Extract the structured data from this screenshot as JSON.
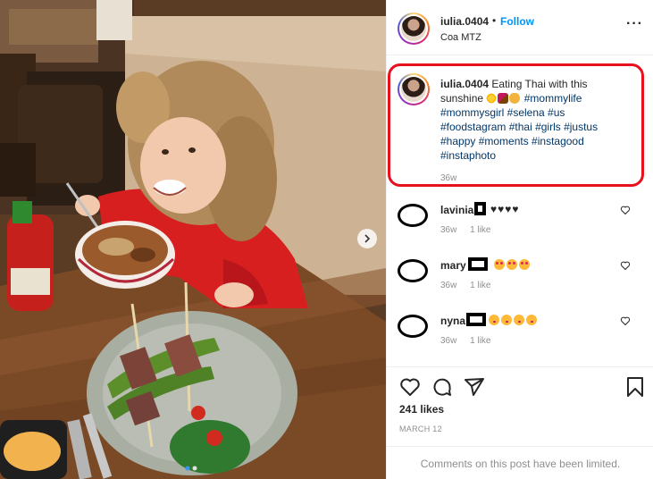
{
  "post": {
    "username": "iulia.0404",
    "separator": "•",
    "follow_label": "Follow",
    "location": "Coa MTZ",
    "more_label": "···"
  },
  "caption": {
    "username": "iulia.0404",
    "text_before": "Eating Thai with this sunshine",
    "hashtags": "#mommylife #mommysgirl #selena #us #foodstagram #thai #girls #justus #happy #moments #instagood #instaphoto",
    "time": "36w",
    "emoji_icons": [
      "sun-icon",
      "mother-child-icon",
      "raised-hands-icon"
    ]
  },
  "comments": [
    {
      "username": "lavinia",
      "text": "♥♥♥♥",
      "time": "36w",
      "likes_label": "1 like",
      "emoji": []
    },
    {
      "username": "mary",
      "text": "",
      "time": "36w",
      "likes_label": "1 like",
      "emoji": [
        "love",
        "love",
        "love"
      ]
    },
    {
      "username": "nyna",
      "text": "",
      "time": "36w",
      "likes_label": "1 like",
      "emoji": [
        "kiss",
        "kiss",
        "kiss",
        "kiss"
      ]
    }
  ],
  "stats": {
    "likes_label": "241 likes",
    "date": "MARCH 12"
  },
  "footer": {
    "limited_text": "Comments on this post have been limited."
  },
  "colors": {
    "link": "#0095f6",
    "hashtag": "#00376b",
    "muted": "#8e8e8e",
    "highlight": "#e8101d"
  }
}
